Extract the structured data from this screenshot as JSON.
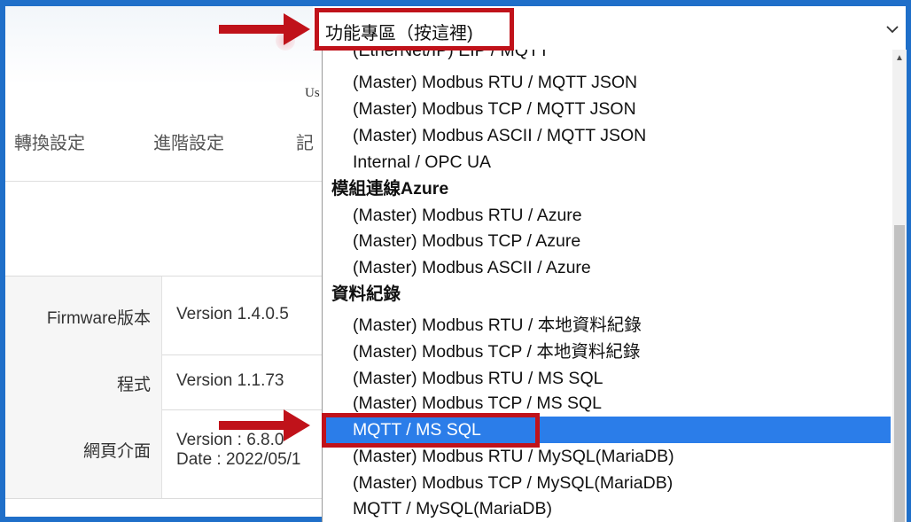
{
  "header": {
    "partial_text": "Us",
    "nav_items": [
      "轉換設定",
      "進階設定",
      "記"
    ]
  },
  "info_table": [
    {
      "label": "Firmware版本",
      "value": "Version 1.4.0.5"
    },
    {
      "label": "程式",
      "value": "Version 1.1.73"
    },
    {
      "label": "網頁介面",
      "value_line1": "Version : 6.8.0",
      "value_line2": "Date : 2022/05/1"
    }
  ],
  "select": {
    "selected_label": "功能專區（按這裡)"
  },
  "dropdown": {
    "options": [
      {
        "label": "(EtherNet/IP) EIP / MQTT",
        "kind": "child"
      },
      {
        "label": "(Master) Modbus RTU / MQTT JSON",
        "kind": "child"
      },
      {
        "label": "(Master) Modbus TCP / MQTT JSON",
        "kind": "child"
      },
      {
        "label": "(Master) Modbus ASCII / MQTT JSON",
        "kind": "child"
      },
      {
        "label": "Internal / OPC UA",
        "kind": "child"
      },
      {
        "label": "模組連線Azure",
        "kind": "group"
      },
      {
        "label": "(Master) Modbus RTU / Azure",
        "kind": "child"
      },
      {
        "label": "(Master) Modbus TCP / Azure",
        "kind": "child"
      },
      {
        "label": "(Master) Modbus ASCII / Azure",
        "kind": "child"
      },
      {
        "label": "資料紀錄",
        "kind": "group"
      },
      {
        "label": "(Master) Modbus RTU / 本地資料紀錄",
        "kind": "child"
      },
      {
        "label": "(Master) Modbus TCP / 本地資料紀錄",
        "kind": "child"
      },
      {
        "label": "(Master) Modbus RTU / MS SQL",
        "kind": "child"
      },
      {
        "label": "(Master) Modbus TCP / MS SQL",
        "kind": "child"
      },
      {
        "label": "MQTT / MS SQL",
        "kind": "selected"
      },
      {
        "label": "(Master) Modbus RTU / MySQL(MariaDB)",
        "kind": "child"
      },
      {
        "label": "(Master) Modbus TCP / MySQL(MariaDB)",
        "kind": "child"
      },
      {
        "label": "MQTT / MySQL(MariaDB)",
        "kind": "child"
      }
    ]
  },
  "colors": {
    "frame_border": "#1f6fc9",
    "annotation_red": "#c0121a",
    "selected_bg": "#2b7de9"
  },
  "icons": {
    "select_chevron": "chevron-down-icon",
    "scroll_up": "scroll-up-arrow-icon"
  }
}
